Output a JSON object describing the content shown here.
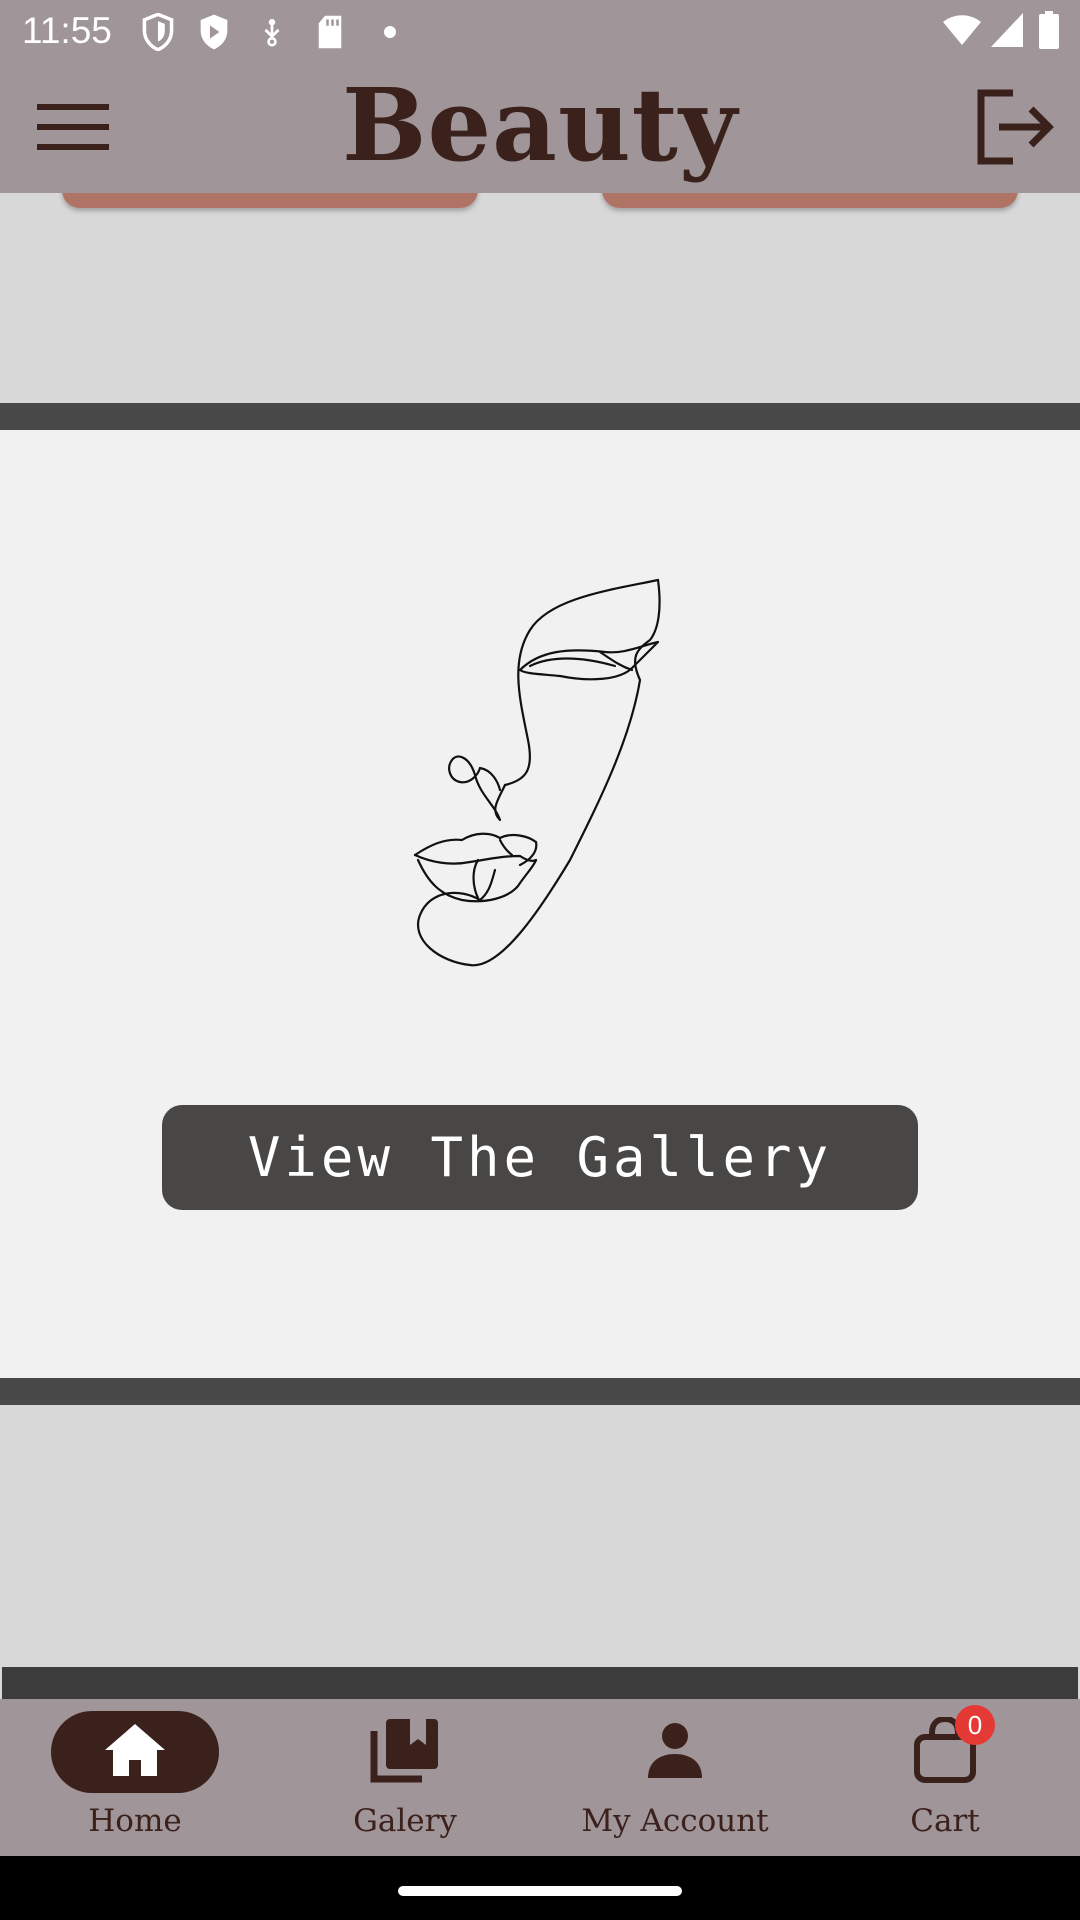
{
  "status_bar": {
    "time": "11:55",
    "icons": [
      "shield-outline-icon",
      "play-shield-icon",
      "usb-icon",
      "sd-card-icon",
      "dot-icon",
      "wifi-icon",
      "signal-icon",
      "battery-icon"
    ]
  },
  "header": {
    "brand": "Beauty",
    "menu_icon": "hamburger-menu-icon",
    "logout_icon": "logout-icon"
  },
  "gallery": {
    "button_label": "View The Gallery",
    "image": "line-art-face"
  },
  "bottom_nav": {
    "items": [
      {
        "label": "Home",
        "icon": "home-icon",
        "active": true
      },
      {
        "label": "Galery",
        "icon": "photo-library-icon",
        "active": false
      },
      {
        "label": "My Account",
        "icon": "person-icon",
        "active": false
      },
      {
        "label": "Cart",
        "icon": "shopping-bag-icon",
        "active": false
      }
    ],
    "cart_badge": "0"
  },
  "colors": {
    "header_bg": "#a09599",
    "brand_text": "#3b211c",
    "accent_button": "#b07466",
    "divider": "#484848",
    "gallery_button": "#494745",
    "badge": "#e53935"
  }
}
